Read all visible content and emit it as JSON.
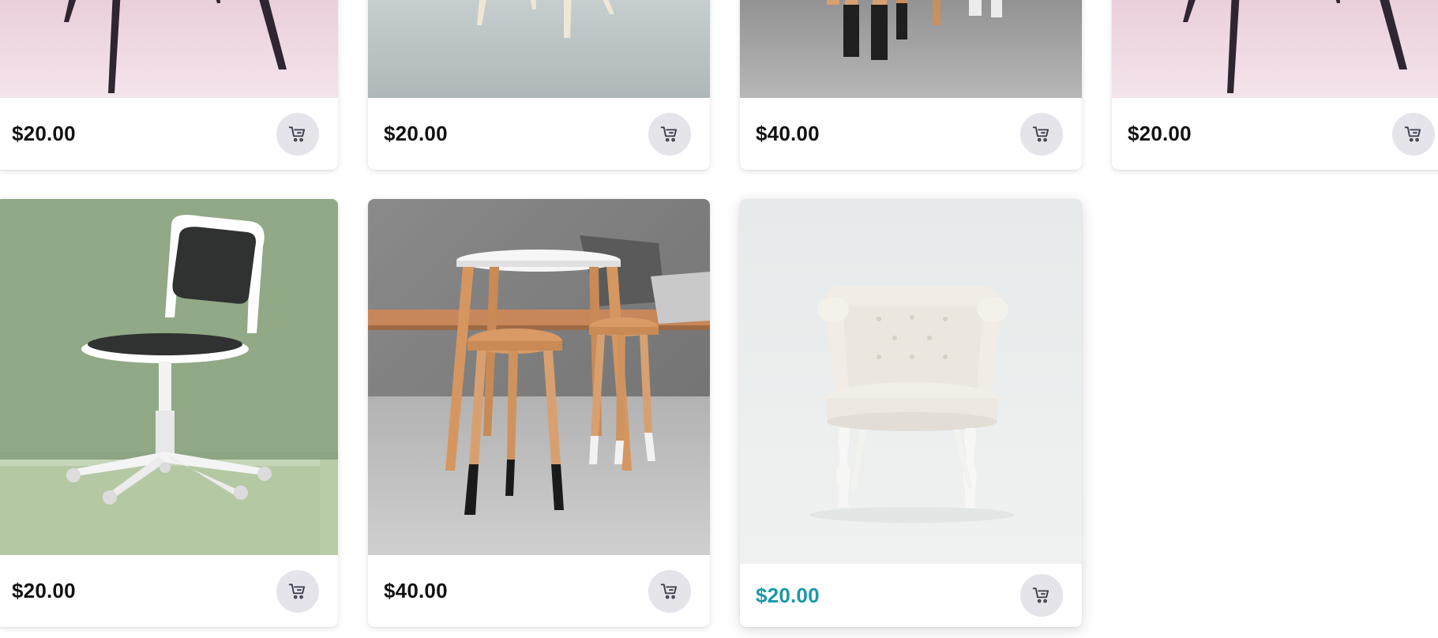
{
  "products": [
    {
      "price": "$20.00",
      "image": "pink-chair-legs"
    },
    {
      "price": "$20.00",
      "image": "grey-chair-legs"
    },
    {
      "price": "$40.00",
      "image": "stool-legs-concrete"
    },
    {
      "price": "$20.00",
      "image": "pink-chair-legs"
    },
    {
      "price": "$20.00",
      "image": "white-office-chair-green-wall"
    },
    {
      "price": "$40.00",
      "image": "wooden-table-and-stools"
    },
    {
      "price": "$20.00",
      "image": "white-tufted-armchair"
    }
  ],
  "icons": {
    "cart": "shopping-cart-icon"
  },
  "colors": {
    "price_text": "#111111",
    "price_highlight": "#1a98a8",
    "cart_button_bg": "#e4e4ea",
    "cart_icon": "#3a3a48"
  }
}
